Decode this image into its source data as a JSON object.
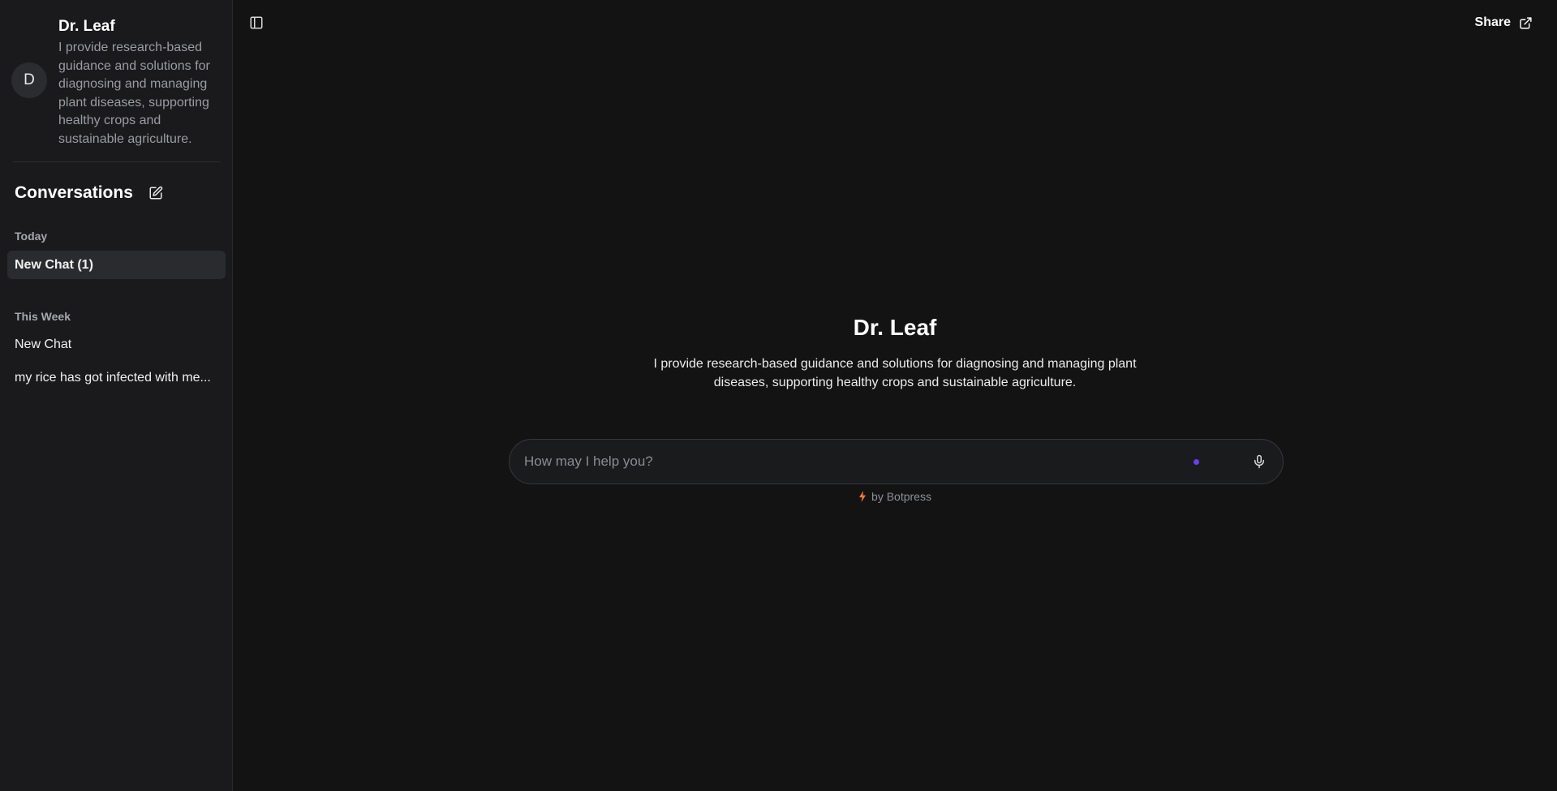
{
  "bot": {
    "name": "Dr. Leaf",
    "avatar_initial": "D",
    "description": "I provide research-based guidance and solutions for diagnosing and managing plant diseases, supporting healthy crops and sustainable agriculture."
  },
  "sidebar": {
    "conversations_title": "Conversations",
    "groups": [
      {
        "label": "Today",
        "items": [
          {
            "label": "New Chat (1)",
            "active": true
          }
        ]
      },
      {
        "label": "This Week",
        "items": [
          {
            "label": "New Chat",
            "active": false
          },
          {
            "label": "my rice has got infected with me...",
            "active": false
          }
        ]
      }
    ]
  },
  "header": {
    "share_label": "Share"
  },
  "hero": {
    "title": "Dr. Leaf",
    "description": "I provide research-based guidance and solutions for diagnosing and managing plant diseases, supporting healthy crops and sustainable agriculture."
  },
  "composer": {
    "placeholder": "How may I help you?",
    "value": ""
  },
  "footer": {
    "powered_by": "by Botpress"
  },
  "colors": {
    "background": "#131314",
    "sidebar": "#1a1a1c",
    "accent_dot": "#6a3df2",
    "bolt": "#f27b35"
  },
  "icons": {
    "edit": "edit-icon",
    "sidebar_toggle": "sidebar-toggle-icon",
    "share": "external-link-icon",
    "mic": "microphone-icon",
    "bolt": "lightning-bolt-icon"
  }
}
